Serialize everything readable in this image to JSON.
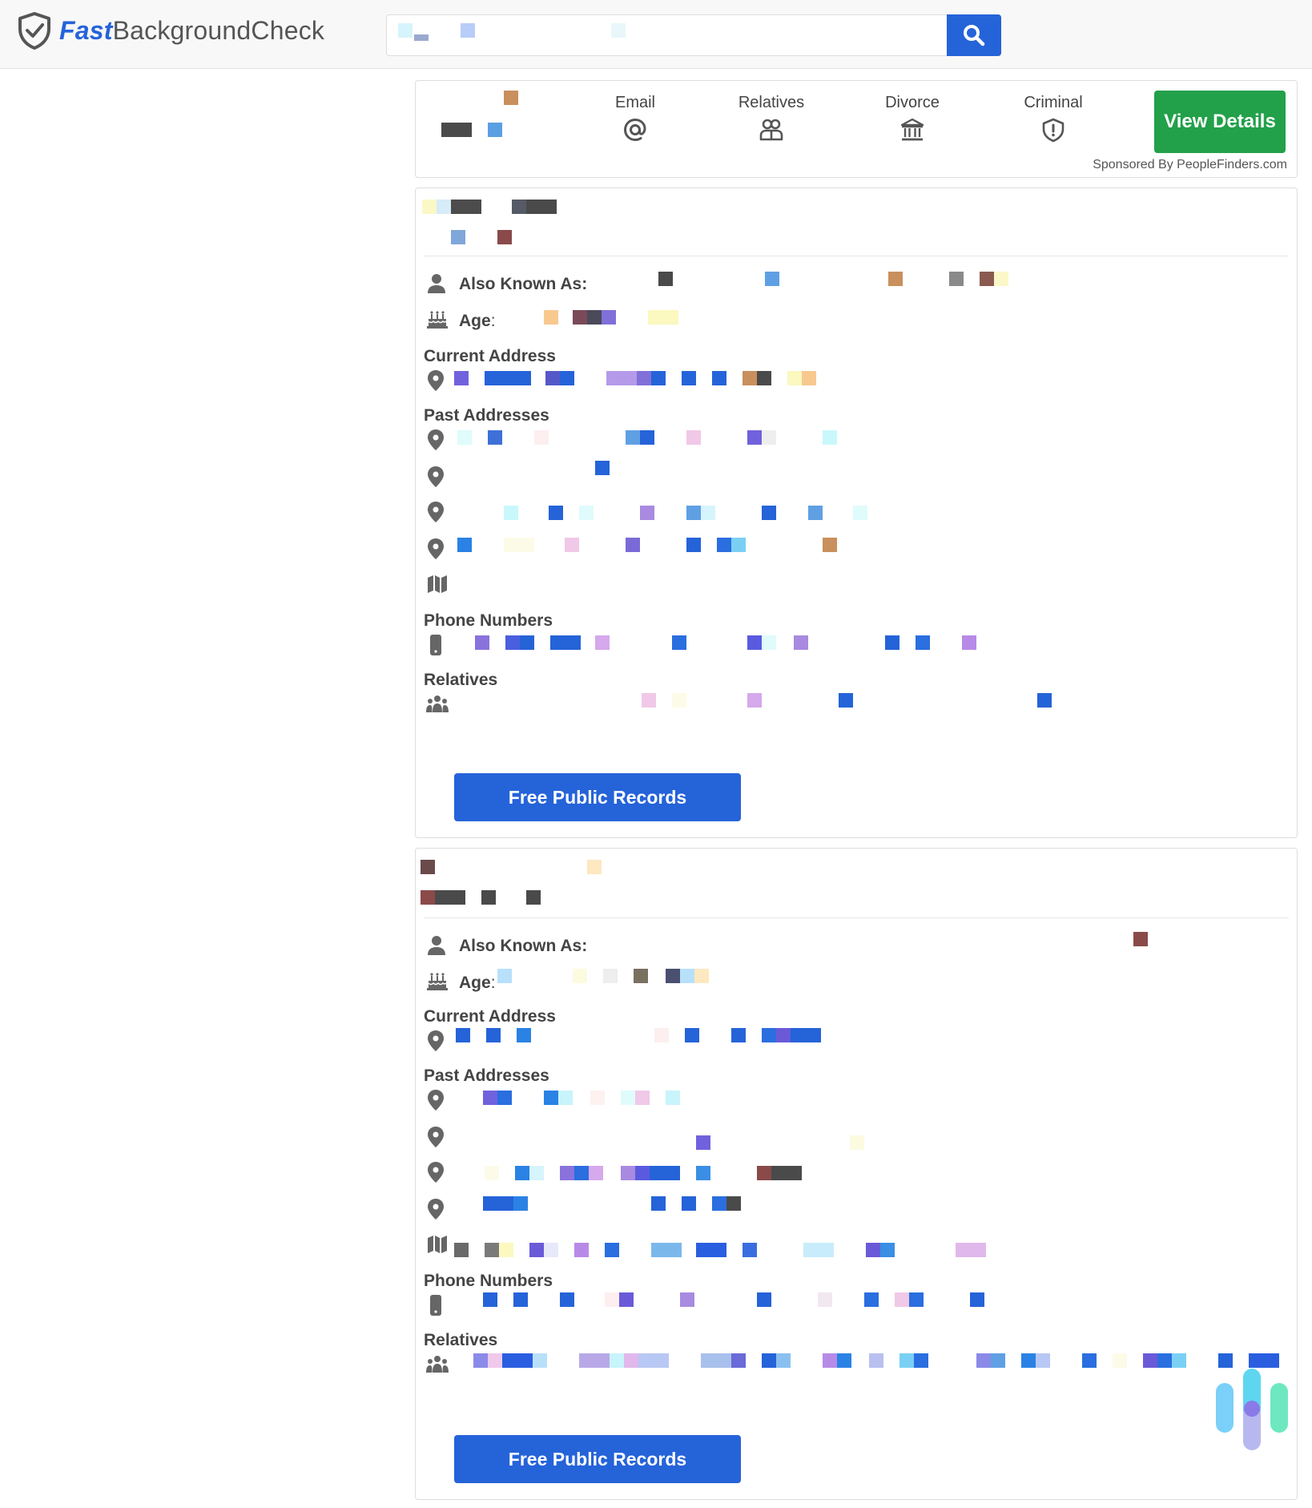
{
  "header": {
    "brand_fast": "Fast",
    "brand_rest": "BackgroundCheck",
    "search_value": "",
    "search_placeholder": ""
  },
  "ad": {
    "items": [
      {
        "label": "Email",
        "icon": "at-icon"
      },
      {
        "label": "Relatives",
        "icon": "people-icon"
      },
      {
        "label": "Divorce",
        "icon": "courthouse-icon"
      },
      {
        "label": "Criminal",
        "icon": "shield-alert-icon"
      }
    ],
    "button_label": "View Details",
    "sponsored_text": "Sponsored By PeopleFinders.com"
  },
  "labels": {
    "also_known_as": "Also Known As:",
    "age": "Age",
    "age_colon": ":",
    "current_address": "Current Address",
    "past_addresses": "Past Addresses",
    "phone_numbers": "Phone Numbers",
    "relatives": "Relatives"
  },
  "cards": [
    {
      "cta_label": "Free Public Records"
    },
    {
      "cta_label": "Free Public Records"
    }
  ],
  "colors": {
    "brand_blue": "#2563d9",
    "green": "#22a04a",
    "icon_gray": "#666666"
  }
}
